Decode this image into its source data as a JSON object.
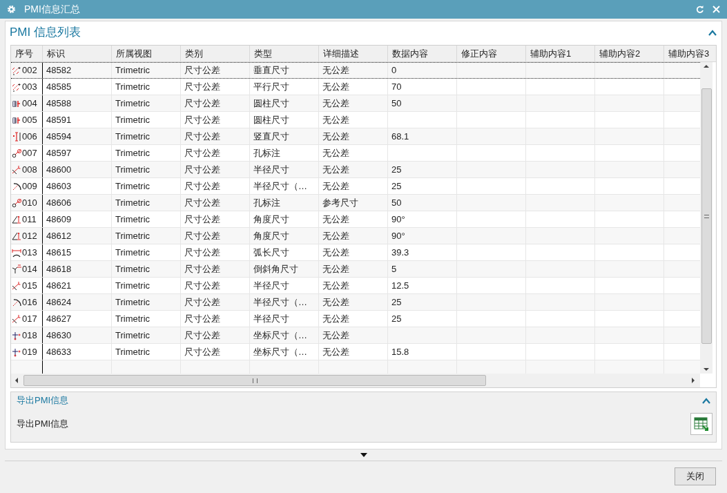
{
  "window": {
    "title": "PMI信息汇总"
  },
  "list_section": {
    "title": "PMI 信息列表",
    "expanded": true
  },
  "table": {
    "columns": [
      "序号",
      "标识",
      "所属视图",
      "类别",
      "类型",
      "详细描述",
      "数据内容",
      "修正内容",
      "辅助内容1",
      "辅助内容2",
      "辅助内容3"
    ],
    "rows": [
      {
        "kind": "linear",
        "focused": true,
        "cells": [
          "002",
          "48582",
          "Trimetric",
          "尺寸公差",
          "垂直尺寸",
          "无公差",
          "0"
        ]
      },
      {
        "kind": "linear",
        "focused": false,
        "cells": [
          "003",
          "48585",
          "Trimetric",
          "尺寸公差",
          "平行尺寸",
          "无公差",
          "70"
        ]
      },
      {
        "kind": "cylinder",
        "focused": false,
        "cells": [
          "004",
          "48588",
          "Trimetric",
          "尺寸公差",
          "圆柱尺寸",
          "无公差",
          "50"
        ]
      },
      {
        "kind": "cylinder",
        "focused": false,
        "cells": [
          "005",
          "48591",
          "Trimetric",
          "尺寸公差",
          "圆柱尺寸",
          "无公差",
          ""
        ]
      },
      {
        "kind": "vertical",
        "focused": false,
        "cells": [
          "006",
          "48594",
          "Trimetric",
          "尺寸公差",
          "竖直尺寸",
          "无公差",
          "68.1"
        ]
      },
      {
        "kind": "hole",
        "focused": false,
        "cells": [
          "007",
          "48597",
          "Trimetric",
          "尺寸公差",
          "孔标注",
          "无公差",
          ""
        ]
      },
      {
        "kind": "radius",
        "focused": false,
        "cells": [
          "008",
          "48600",
          "Trimetric",
          "尺寸公差",
          "半径尺寸",
          "无公差",
          "25"
        ]
      },
      {
        "kind": "arc",
        "focused": false,
        "cells": [
          "009",
          "48603",
          "Trimetric",
          "尺寸公差",
          "半径尺寸（…",
          "无公差",
          "25"
        ]
      },
      {
        "kind": "hole",
        "focused": false,
        "cells": [
          "010",
          "48606",
          "Trimetric",
          "尺寸公差",
          "孔标注",
          "参考尺寸",
          "50"
        ]
      },
      {
        "kind": "angle",
        "focused": false,
        "cells": [
          "011",
          "48609",
          "Trimetric",
          "尺寸公差",
          "角度尺寸",
          "无公差",
          "90°"
        ]
      },
      {
        "kind": "angle",
        "focused": false,
        "cells": [
          "012",
          "48612",
          "Trimetric",
          "尺寸公差",
          "角度尺寸",
          "无公差",
          "90°"
        ]
      },
      {
        "kind": "arclength",
        "focused": false,
        "cells": [
          "013",
          "48615",
          "Trimetric",
          "尺寸公差",
          "弧长尺寸",
          "无公差",
          "39.3"
        ]
      },
      {
        "kind": "chamfer",
        "focused": false,
        "cells": [
          "014",
          "48618",
          "Trimetric",
          "尺寸公差",
          "倒斜角尺寸",
          "无公差",
          "5"
        ]
      },
      {
        "kind": "radius",
        "focused": false,
        "cells": [
          "015",
          "48621",
          "Trimetric",
          "尺寸公差",
          "半径尺寸",
          "无公差",
          "12.5"
        ]
      },
      {
        "kind": "arc",
        "focused": false,
        "cells": [
          "016",
          "48624",
          "Trimetric",
          "尺寸公差",
          "半径尺寸（…",
          "无公差",
          "25"
        ]
      },
      {
        "kind": "radius",
        "focused": false,
        "cells": [
          "017",
          "48627",
          "Trimetric",
          "尺寸公差",
          "半径尺寸",
          "无公差",
          "25"
        ]
      },
      {
        "kind": "ordinate",
        "focused": false,
        "cells": [
          "018",
          "48630",
          "Trimetric",
          "尺寸公差",
          "坐标尺寸（…",
          "无公差",
          ""
        ]
      },
      {
        "kind": "ordinate",
        "focused": false,
        "cells": [
          "019",
          "48633",
          "Trimetric",
          "尺寸公差",
          "坐标尺寸（…",
          "无公差",
          "15.8"
        ]
      }
    ]
  },
  "export_section": {
    "title": "导出PMI信息",
    "expanded": true,
    "label": "导出PMI信息"
  },
  "buttons": [
    "关闭"
  ]
}
